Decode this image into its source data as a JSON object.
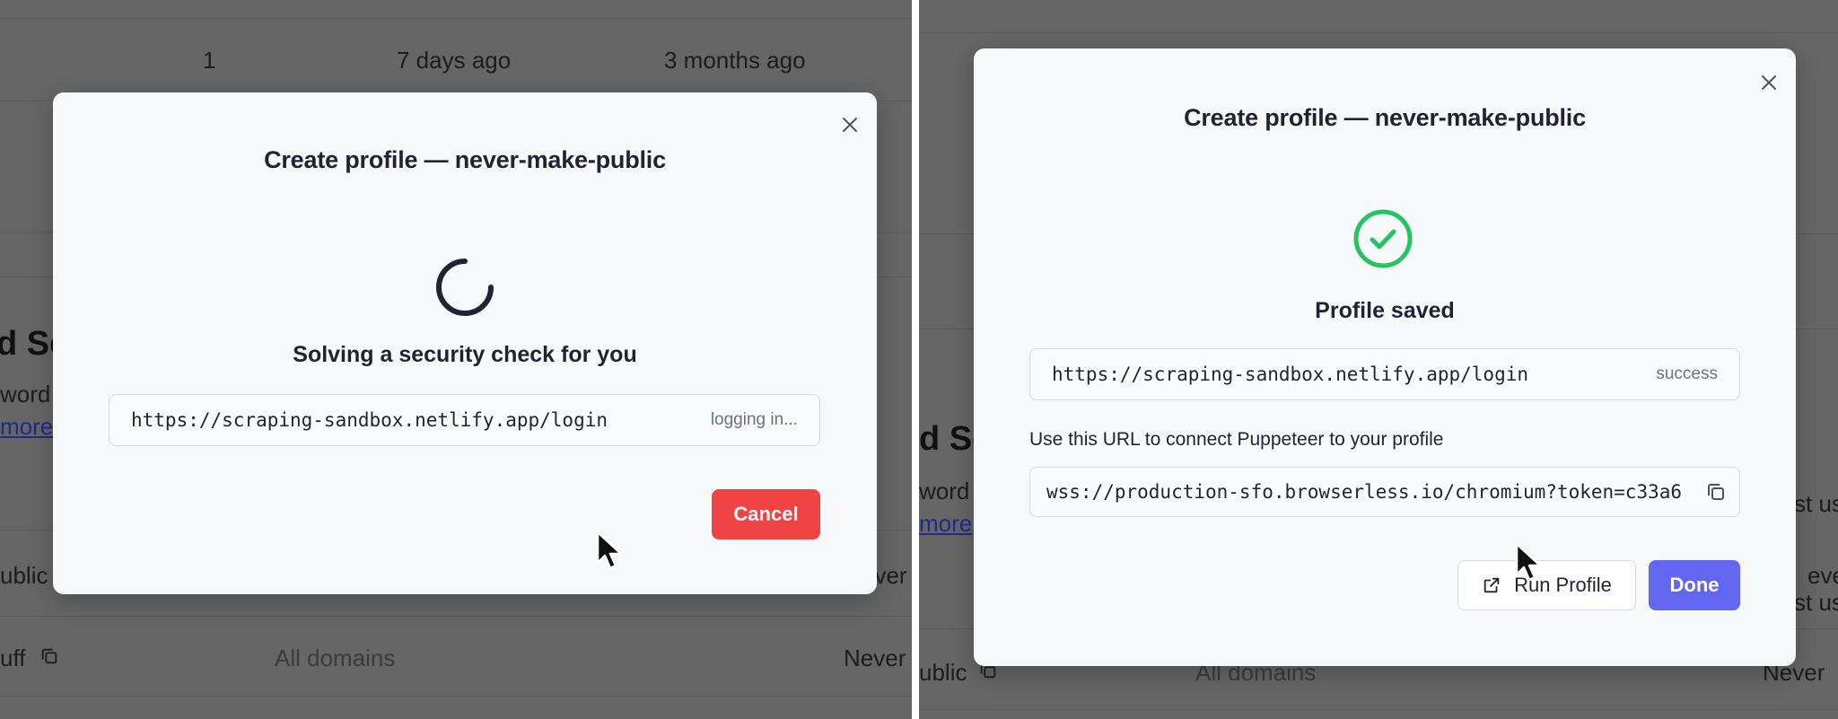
{
  "background_left": {
    "row_count": "1",
    "row_updated": "7 days ago",
    "row_created": "3 months ago",
    "heading_fragment": "d Se",
    "desc_fragment": "word",
    "link_fragment": "more",
    "row2_name_fragment": "ublic",
    "row2_expiry_fragment": "ever",
    "row3_name_fragment": "uff",
    "row3_domains": "All domains",
    "row3_expiry": "Never"
  },
  "background_right": {
    "heading_fragment": "d Se",
    "desc_fragment": "word",
    "desc_right_fragment": "st us",
    "link_fragment": "more",
    "row2_expiry_fragment": "ever",
    "row2_right_fragment": "st us",
    "row3_name_fragment": "ublic",
    "row3_domains": "All domains",
    "row3_expiry": "Never"
  },
  "modal_loading": {
    "title": "Create profile — never-make-public",
    "status_heading": "Solving a security check for you",
    "url": "https://scraping-sandbox.netlify.app/login",
    "url_status": "logging in...",
    "cancel_label": "Cancel"
  },
  "modal_saved": {
    "title": "Create profile — never-make-public",
    "status_heading": "Profile saved",
    "url": "https://scraping-sandbox.netlify.app/login",
    "url_status": "success",
    "connect_label": "Use this URL to connect Puppeteer to your profile",
    "ws_url": "wss://production-sfo.browserless.io/chromium?token=c33a6",
    "run_label": "Run Profile",
    "done_label": "Done"
  },
  "colors": {
    "cancel": "#ef4444",
    "done": "#6366f1",
    "success_green": "#22c55e",
    "spinner": "#1f2430"
  },
  "icons": {
    "close": "close-icon",
    "spinner": "spinner-icon",
    "check": "check-circle-icon",
    "copy": "copy-icon",
    "external": "external-link-icon",
    "cursor": "mouse-cursor-icon"
  }
}
